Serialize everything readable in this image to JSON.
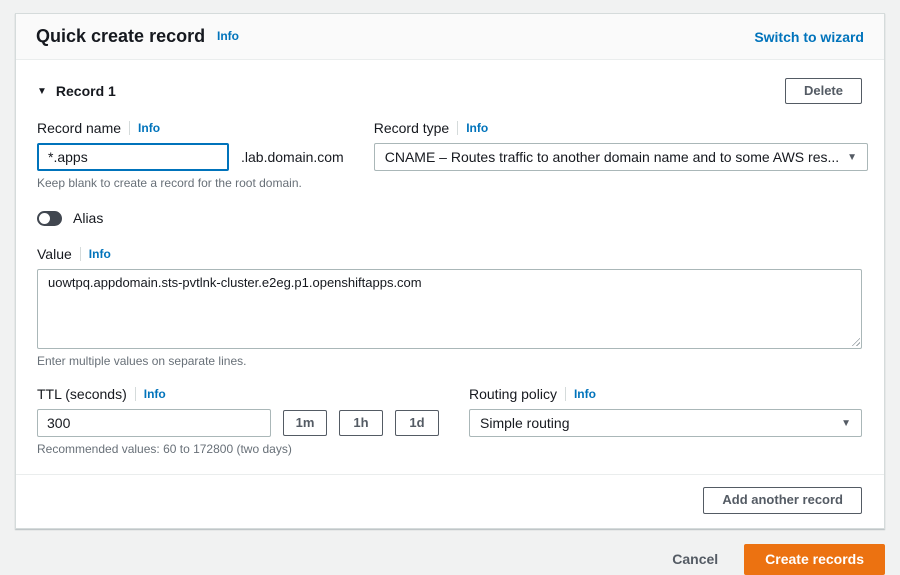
{
  "header": {
    "title": "Quick create record",
    "info_label": "Info",
    "switch_link": "Switch to wizard"
  },
  "record": {
    "title": "Record 1",
    "delete_button": "Delete",
    "record_name": {
      "label": "Record name",
      "info_label": "Info",
      "value": "*.apps",
      "suffix": ".lab.domain.com",
      "hint": "Keep blank to create a record for the root domain."
    },
    "record_type": {
      "label": "Record type",
      "info_label": "Info",
      "selected": "CNAME – Routes traffic to another domain name and to some AWS res..."
    },
    "alias": {
      "label": "Alias",
      "state": "off"
    },
    "value": {
      "label": "Value",
      "info_label": "Info",
      "value": "uowtpq.appdomain.sts-pvtlnk-cluster.e2eg.p1.openshiftapps.com",
      "hint": "Enter multiple values on separate lines."
    },
    "ttl": {
      "label": "TTL (seconds)",
      "info_label": "Info",
      "value": "300",
      "quick_buttons": [
        "1m",
        "1h",
        "1d"
      ],
      "hint": "Recommended values: 60 to 172800 (two days)"
    },
    "routing_policy": {
      "label": "Routing policy",
      "info_label": "Info",
      "selected": "Simple routing"
    }
  },
  "card_footer": {
    "add_button": "Add another record"
  },
  "page_footer": {
    "cancel_label": "Cancel",
    "create_label": "Create records"
  },
  "icons": {
    "collapse_triangle": "▼",
    "dropdown_arrow": "▼"
  },
  "colors": {
    "link_blue": "#0073bb",
    "primary_orange": "#ec7211",
    "button_gray": "#545b64"
  }
}
